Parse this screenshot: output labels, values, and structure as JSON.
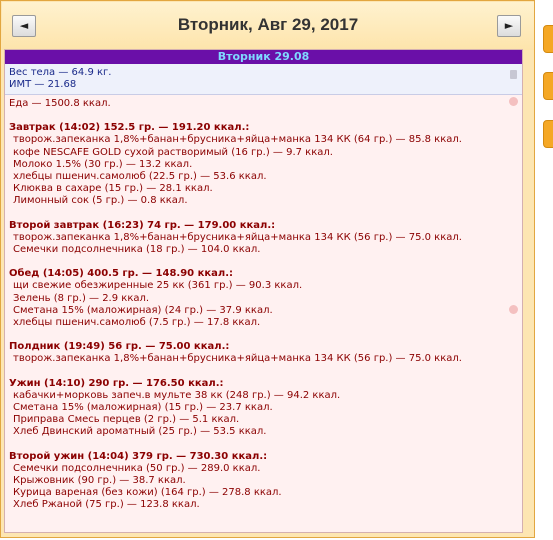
{
  "header": {
    "title": "Вторник, Авг 29, 2017",
    "prev_label": "◄",
    "next_label": "►"
  },
  "day_band": "Вторник 29.08",
  "body": {
    "weight": "Вес тела — 64.9 кг.",
    "bmi": "ИМТ — 21.68"
  },
  "total": "Еда — 1500.8 ккал.",
  "meals": [
    {
      "title": "Завтрак (14:02) 152.5 гр. — 191.20 ккал.:",
      "items": [
        "творож.запеканка 1,8%+банан+брусника+яйца+манка 134 КК (64 гр.) — 85.8 ккал.",
        "кофе NESCAFE GOLD сухой растворимый (16 гр.) — 9.7 ккал.",
        "Молоко 1.5% (30 гр.) — 13.2 ккал.",
        "хлебцы пшенич.самолюб (22.5 гр.) — 53.6 ккал.",
        "Клюква в сахаре (15 гр.) — 28.1 ккал.",
        "Лимонный сок (5 гр.) — 0.8 ккал."
      ]
    },
    {
      "title": "Второй завтрак (16:23) 74 гр. — 179.00 ккал.:",
      "items": [
        "творож.запеканка 1,8%+банан+брусника+яйца+манка 134 КК (56 гр.) — 75.0 ккал.",
        "Семечки подсолнечника (18 гр.) — 104.0 ккал."
      ]
    },
    {
      "title": "Обед (14:05) 400.5 гр. — 148.90 ккал.:",
      "items": [
        "щи свежие обезжиренные 25 кк (361 гр.) — 90.3 ккал.",
        "Зелень (8 гр.) — 2.9 ккал.",
        "Сметана 15% (маложирная) (24 гр.) — 37.9 ккал.",
        "хлебцы пшенич.самолюб (7.5 гр.) — 17.8 ккал."
      ]
    },
    {
      "title": "Полдник (19:49) 56 гр. — 75.00 ккал.:",
      "items": [
        "творож.запеканка 1,8%+банан+брусника+яйца+манка 134 КК (56 гр.) — 75.0 ккал."
      ]
    },
    {
      "title": "Ужин (14:10) 290 гр. — 176.50 ккал.:",
      "items": [
        "кабачки+морковь запеч.в мульте 38 кк (248 гр.) — 94.2 ккал.",
        "Сметана 15% (маложирная) (15 гр.) — 23.7 ккал.",
        "Приправа Смесь перцев (2 гр.) — 5.1 ккал.",
        "Хлеб Двинский ароматный (25 гр.) — 53.5 ккал."
      ]
    },
    {
      "title": "Второй ужин (14:04) 379 гр. — 730.30 ккал.:",
      "items": [
        "Семечки подсолнечника (50 гр.) — 289.0 ккал.",
        "Крыжовник (90 гр.) — 38.7 ккал.",
        "Курица вареная (без кожи) (164 гр.) — 278.8 ккал.",
        "Хлеб Ржаной (75 гр.) — 123.8 ккал."
      ]
    }
  ]
}
